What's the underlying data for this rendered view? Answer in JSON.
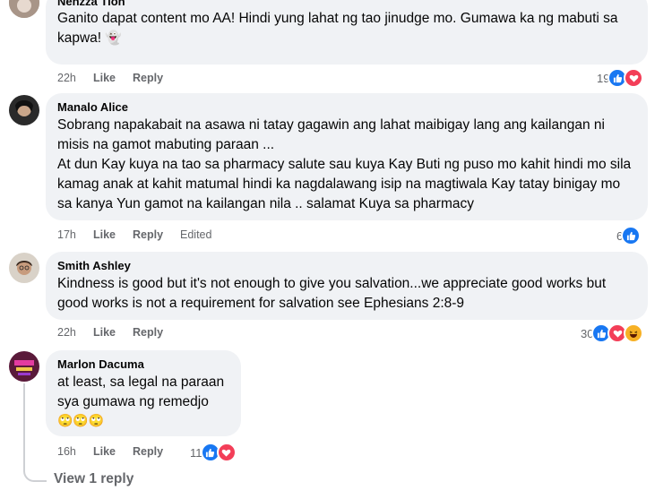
{
  "comments": [
    {
      "author": "Nenzza Tion",
      "text": "Ganito dapat content mo AA! Hindi yung lahat ng tao jinudge mo. Gumawa ka ng mabuti sa kapwa! ",
      "emoji": "👻",
      "time": "22h",
      "like_label": "Like",
      "reply_label": "Reply",
      "reaction_count": "19",
      "reactions": [
        "like-icon",
        "love-icon"
      ]
    },
    {
      "author": "Manalo Alice",
      "text": "Sobrang napakabait na asawa ni tatay gagawin ang lahat maibigay lang ang kailangan ni misis na gamot mabuting paraan ...\nAt dun Kay kuya na tao sa pharmacy salute sau kuya Kay Buti ng puso mo kahit hindi mo sila kamag anak at kahit matumal hindi ka nagdalawang isip na magtiwala Kay tatay binigay mo sa kanya Yun gamot na kailangan nila .. salamat Kuya sa pharmacy",
      "time": "17h",
      "like_label": "Like",
      "reply_label": "Reply",
      "edited_label": "Edited",
      "reaction_count": "6",
      "reactions": [
        "like-icon"
      ]
    },
    {
      "author": "Smith Ashley",
      "text": "Kindness is good but it's not enough to give you salvation...we appreciate good works but good works is not a requirement for salvation see Ephesians 2:8-9",
      "time": "22h",
      "like_label": "Like",
      "reply_label": "Reply",
      "reaction_count": "30",
      "reactions": [
        "like-icon",
        "love-icon",
        "haha-icon"
      ]
    },
    {
      "author": "Marlon Dacuma",
      "text": "at least, sa legal na paraan\nsya gumawa ng remedjo",
      "emoji": "🙄🙄🙄",
      "time": "16h",
      "like_label": "Like",
      "reply_label": "Reply",
      "reaction_count": "11",
      "reactions": [
        "like-icon",
        "love-icon"
      ]
    }
  ],
  "view_replies": "View 1 reply",
  "colors": {
    "bubble": "#f0f2f5",
    "meta": "#65676b",
    "like": "#1877f2",
    "love": "#f33e58",
    "haha": "#f7b125"
  }
}
